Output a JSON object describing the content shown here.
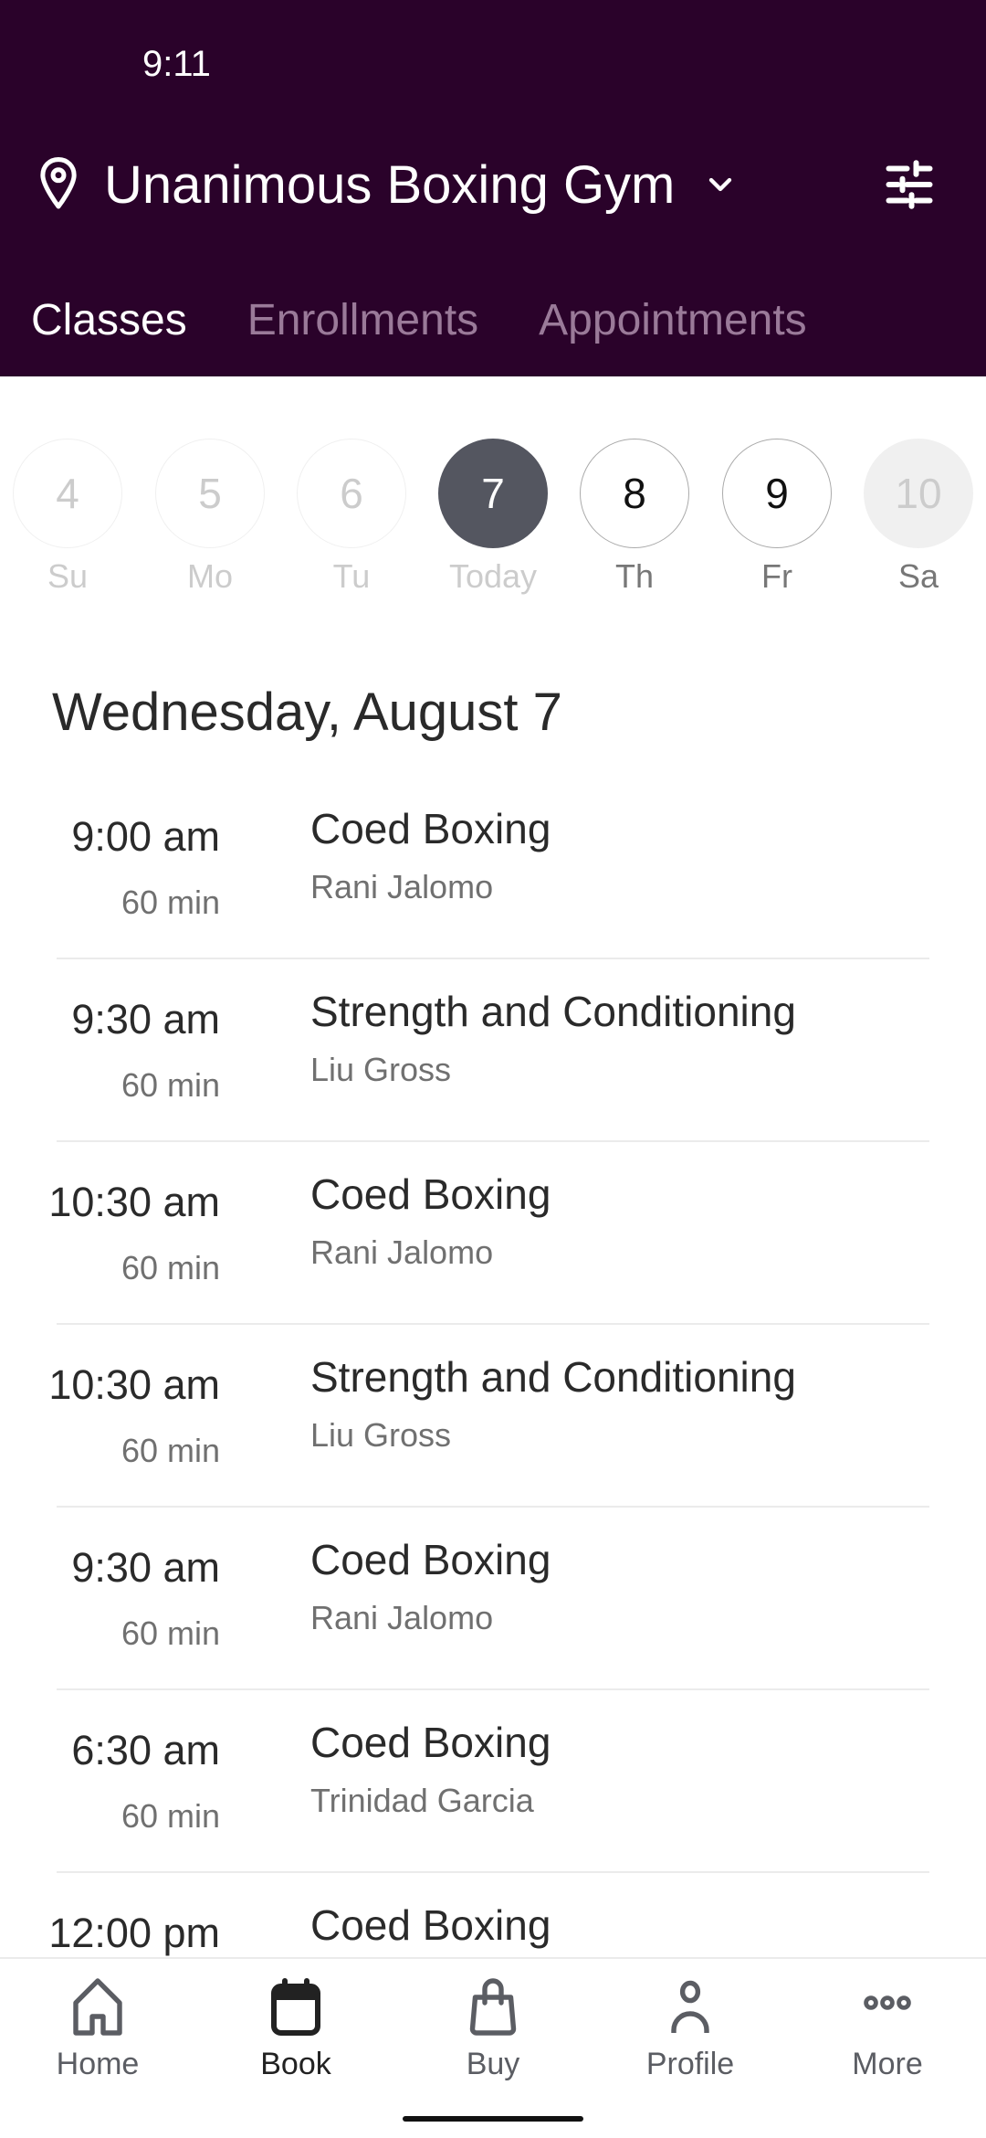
{
  "status_bar": {
    "time": "9:11"
  },
  "header": {
    "location_icon": "map-pin-icon",
    "gym_name": "Unanimous Boxing Gym",
    "dropdown_icon": "chevron-down-icon",
    "filter_icon": "sliders-icon"
  },
  "tabs": [
    {
      "label": "Classes",
      "active": true
    },
    {
      "label": "Enrollments",
      "active": false
    },
    {
      "label": "Appointments",
      "active": false
    }
  ],
  "week": [
    {
      "num": "4",
      "day": "Su",
      "state": "past"
    },
    {
      "num": "5",
      "day": "Mo",
      "state": "past"
    },
    {
      "num": "6",
      "day": "Tu",
      "state": "past"
    },
    {
      "num": "7",
      "day": "Today",
      "state": "selected"
    },
    {
      "num": "8",
      "day": "Th",
      "state": "future"
    },
    {
      "num": "9",
      "day": "Fr",
      "state": "future"
    },
    {
      "num": "10",
      "day": "Sa",
      "state": "unavailable"
    }
  ],
  "date_heading": "Wednesday, August 7",
  "classes": [
    {
      "time": "9:00 am",
      "duration": "60 min",
      "title": "Coed Boxing",
      "teacher": "Rani Jalomo"
    },
    {
      "time": "9:30 am",
      "duration": "60 min",
      "title": "Strength and Conditioning",
      "teacher": "Liu Gross"
    },
    {
      "time": "10:30 am",
      "duration": "60 min",
      "title": "Coed Boxing",
      "teacher": "Rani Jalomo"
    },
    {
      "time": "10:30 am",
      "duration": "60 min",
      "title": "Strength and Conditioning",
      "teacher": "Liu Gross"
    },
    {
      "time": "9:30 am",
      "duration": "60 min",
      "title": "Coed Boxing",
      "teacher": "Rani Jalomo"
    },
    {
      "time": "6:30 am",
      "duration": "60 min",
      "title": "Coed Boxing",
      "teacher": "Trinidad Garcia"
    },
    {
      "time": "12:00 pm",
      "duration": "",
      "title": "Coed Boxing",
      "teacher": ""
    }
  ],
  "bottom_nav": [
    {
      "label": "Home",
      "icon": "home-icon",
      "active": false
    },
    {
      "label": "Book",
      "icon": "calendar-icon",
      "active": true
    },
    {
      "label": "Buy",
      "icon": "shopping-bag-icon",
      "active": false
    },
    {
      "label": "Profile",
      "icon": "person-icon",
      "active": false
    },
    {
      "label": "More",
      "icon": "more-dots-icon",
      "active": false
    }
  ],
  "colors": {
    "header_bg": "#2a022a",
    "tab_inactive": "#9a7a99",
    "selected_day": "#545660"
  }
}
